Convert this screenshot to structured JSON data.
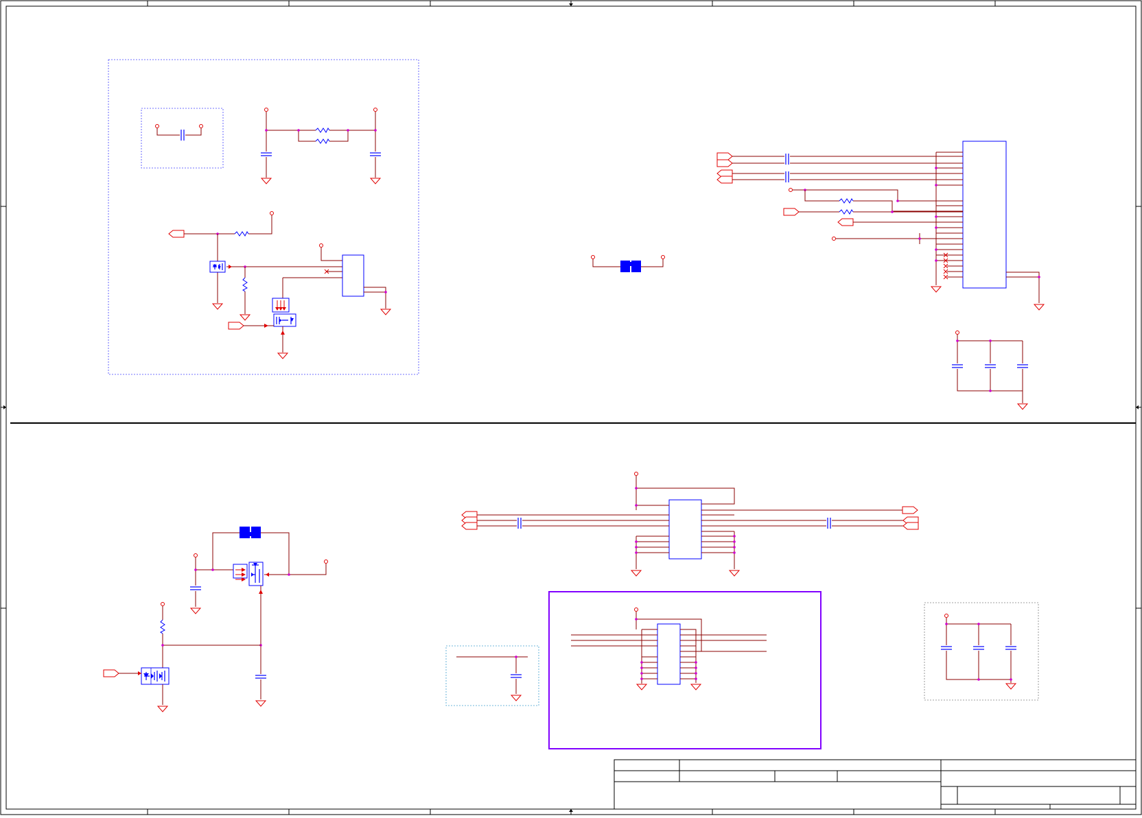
{
  "sheet": {
    "title": "",
    "colors": {
      "border": "#000000",
      "wire": "#8b0000",
      "net_symbol": "#e00000",
      "junction": "#d000d0",
      "component": "#0000ff",
      "region_dashed": "#4040ff",
      "region_cyan": "#40a0d0",
      "region_gray": "#808080",
      "frame_purple": "#8000ff"
    }
  },
  "title_block": {
    "title": "",
    "document_number": "",
    "revision": "",
    "sheet_number": "",
    "date": ""
  },
  "icons": [
    "ground-icon",
    "power-port-icon",
    "net-port-icon",
    "mosfet-icon",
    "capacitor-icon",
    "resistor-icon",
    "ic-icon",
    "solder-jumper-icon",
    "no-connect-icon"
  ]
}
